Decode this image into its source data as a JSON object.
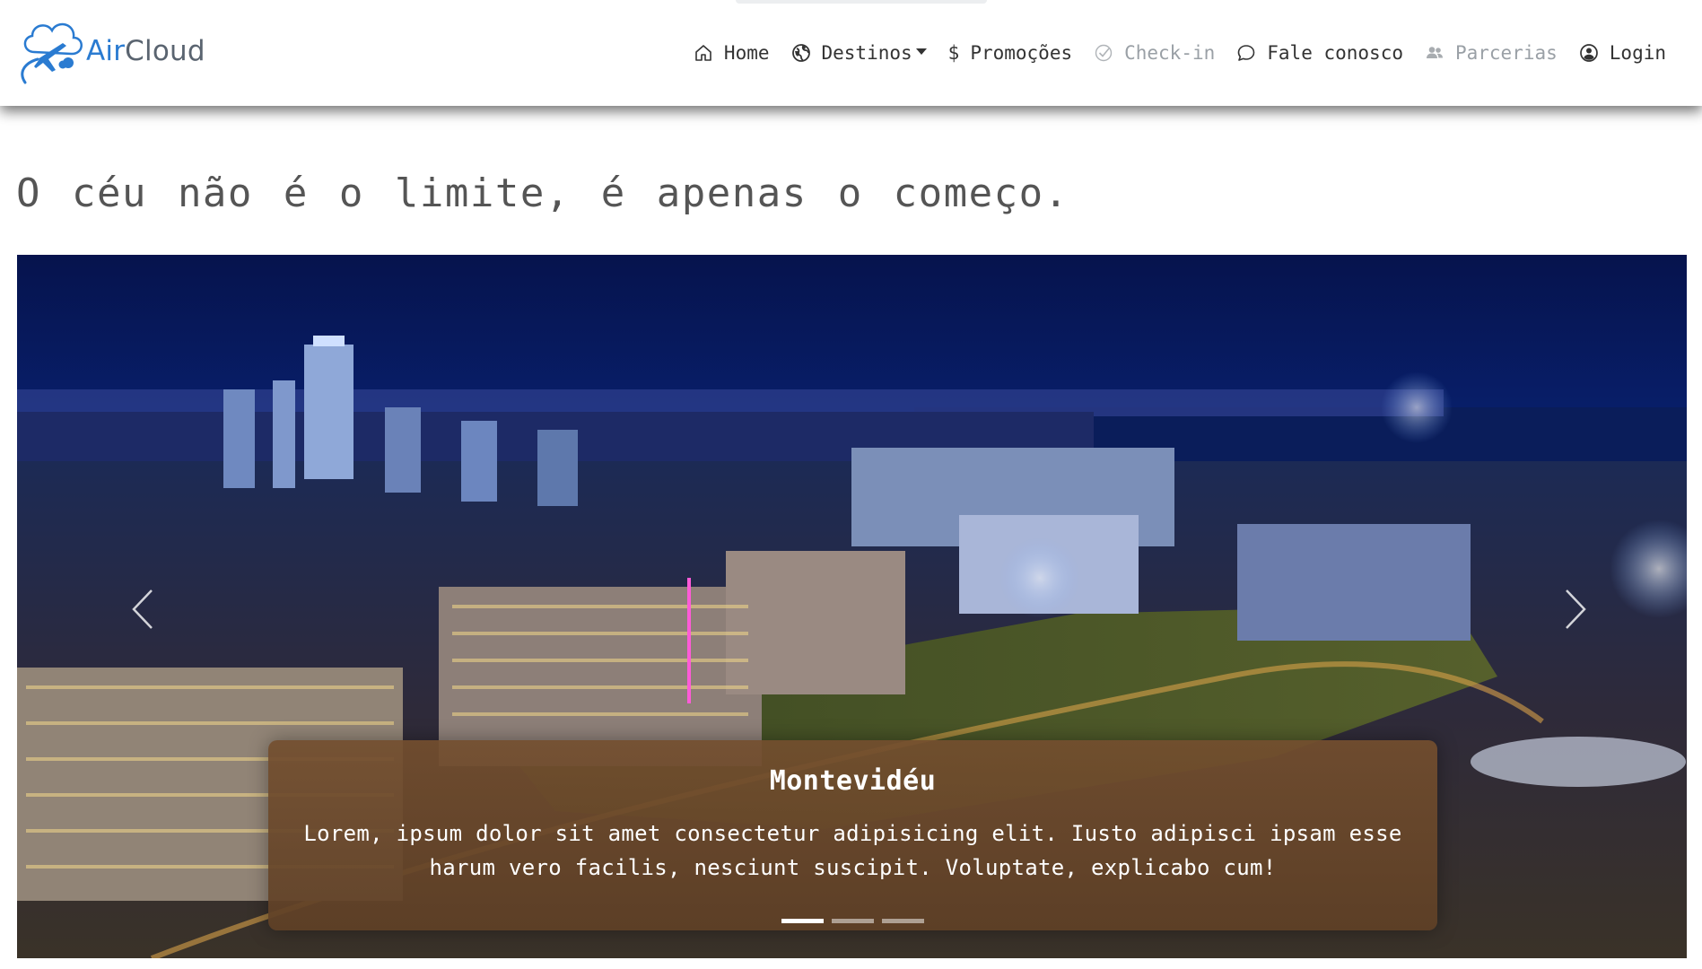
{
  "brand": {
    "name_part1": "Air",
    "name_part2": "Cloud",
    "logo_icon": "plane-cloud-logo",
    "accent_color": "#2a7bd1"
  },
  "nav": {
    "items": [
      {
        "label": "Home",
        "icon": "home-icon",
        "disabled": false
      },
      {
        "label": "Destinos",
        "icon": "globe-icon",
        "disabled": false,
        "dropdown": true
      },
      {
        "label": "Promoções",
        "icon": "dollar-icon",
        "disabled": false
      },
      {
        "label": "Check-in",
        "icon": "check-circle-icon",
        "disabled": true
      },
      {
        "label": "Fale conosco",
        "icon": "chat-icon",
        "disabled": false
      },
      {
        "label": "Parcerias",
        "icon": "people-icon",
        "disabled": true
      },
      {
        "label": "Login",
        "icon": "user-circle-icon",
        "disabled": false
      }
    ]
  },
  "hero": {
    "tagline": "O céu não é o limite, é apenas o começo."
  },
  "carousel": {
    "slide_title": "Montevidéu",
    "slide_text": "Lorem, ipsum dolor sit amet consectetur adipisicing elit. Iusto adipisci ipsam esse harum vero facilis, nesciunt suscipit. Voluptate, explicabo cum!",
    "active_index": 0,
    "slide_count": 3,
    "caption_color": "#6e4a2c"
  }
}
